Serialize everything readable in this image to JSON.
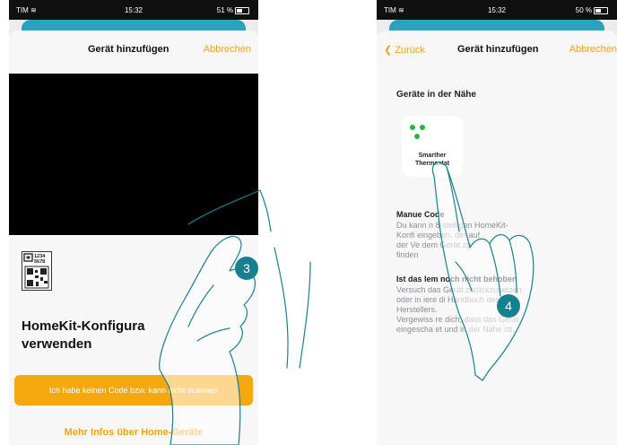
{
  "left_phone": {
    "status": {
      "carrier": "TIM",
      "time": "15:32",
      "battery": "51 %"
    },
    "nav": {
      "title": "Gerät hinzufügen",
      "cancel": "Abbrechen"
    },
    "qr_code_digits": [
      "1234",
      "5678"
    ],
    "homekit_title_line1": "HomeKit-Konfigura",
    "homekit_title_line2": "verwenden",
    "no_code_button": "Ich habe keinen Code bzw. kann nicht scannen",
    "more_info_link": "Mehr Infos über Home-Geräte"
  },
  "right_phone": {
    "status": {
      "carrier": "TIM",
      "time": "15:32",
      "battery": "50 %"
    },
    "nav": {
      "back": "Zurück",
      "title": "Gerät hinzufügen",
      "cancel": "Abbrechen"
    },
    "nearby_title": "Geräte in der Nähe",
    "device": {
      "line1": "Smarther",
      "line2": "Thermostat"
    },
    "manual_title": "Manue Code",
    "manual_text": [
      "Du kann n 8-stelligen HomeKit-",
      "Konfi eingeben, der auf",
      "der Ve dem Gerät zu",
      "finden"
    ],
    "problem_title": "Ist das lem noch nicht behoben",
    "problem_text": [
      "Versuch das Gerät zurückzusetzen,",
      "oder in iere di Handbuch des",
      "Herstellers.",
      "Vergewiss re dich, dass das Gerät",
      "eingescha et und in der Nähe ist."
    ]
  },
  "step_badges": {
    "left": "3",
    "right": "4"
  },
  "colors": {
    "accent": "#f5a20a",
    "button": "#f5a70e",
    "badge": "#16808f",
    "device_dot": "#2ab24a",
    "teal_strip": "#2aa3bf"
  },
  "icons": [
    "wifi-icon",
    "battery-icon",
    "back-chevron-icon",
    "qr-code-icon",
    "pointing-hand-illustration"
  ]
}
